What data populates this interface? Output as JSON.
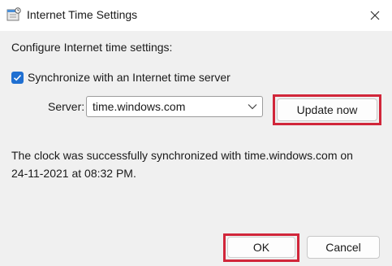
{
  "window": {
    "title": "Internet Time Settings"
  },
  "content": {
    "heading": "Configure Internet time settings:",
    "sync_checkbox_label": "Synchronize with an Internet time server",
    "sync_checked": true,
    "server_label": "Server:",
    "server_value": "time.windows.com",
    "update_button": "Update now",
    "status_line1": "The clock was successfully synchronized with time.windows.com on",
    "status_line2": "24-11-2021 at 08:32 PM."
  },
  "buttons": {
    "ok": "OK",
    "cancel": "Cancel"
  },
  "colors": {
    "accent": "#1f6fd1",
    "highlight": "#d1263a",
    "window_bg": "#f0f0f0"
  },
  "icons": {
    "title": "clock-settings-icon",
    "close": "close-icon",
    "checkbox": "checkmark-icon",
    "dropdown": "chevron-down-icon"
  }
}
